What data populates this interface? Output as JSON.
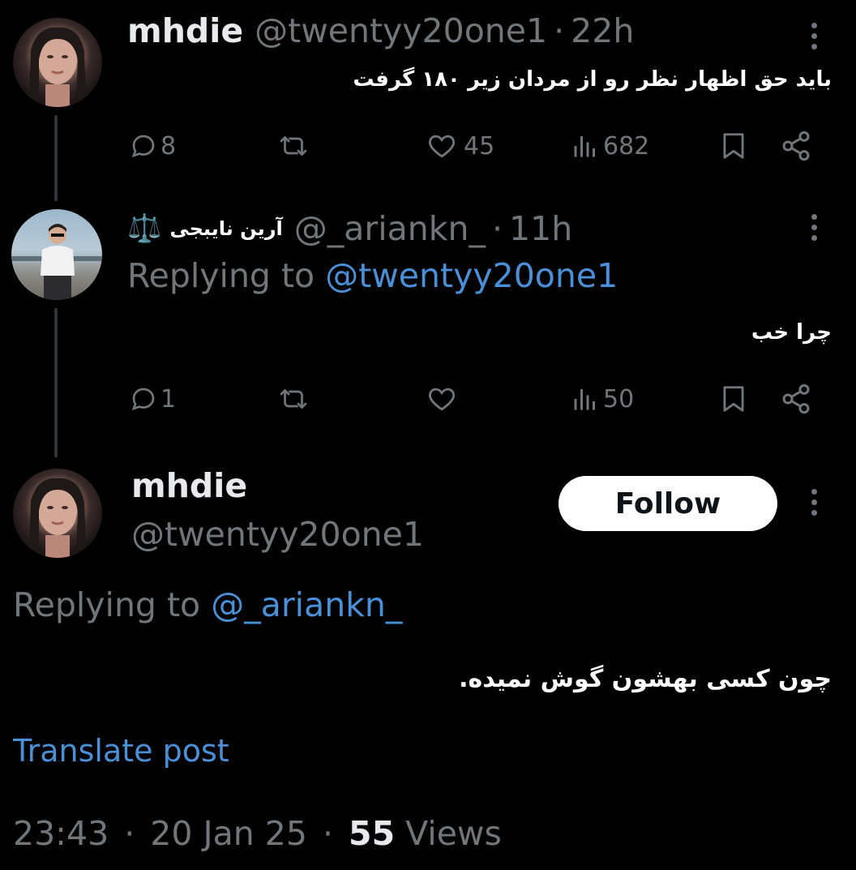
{
  "post1": {
    "name": "mhdie",
    "handle": "@twentyy20one1",
    "separator": "·",
    "time": "22h",
    "text": "باید حق اظهار نظر رو از مردان زیر ۱۸۰ گرفت",
    "replies": "8",
    "likes": "45",
    "views": "682"
  },
  "post2": {
    "name": "آرین نایبجی",
    "name_emoji": "⚖️",
    "handle": "@_ariankn_",
    "separator": "·",
    "time": "11h",
    "replying_prefix": "Replying to",
    "replying_handle": "@twentyy20one1",
    "text": "چرا خب",
    "replies": "1",
    "views": "50"
  },
  "main": {
    "name": "mhdie",
    "handle": "@twentyy20one1",
    "follow_label": "Follow",
    "replying_prefix": "Replying to",
    "replying_handle": "@_ariankn_",
    "text": "چون کسی بهشون گوش نمیده.",
    "translate_label": "Translate post",
    "time": "23:43",
    "date": "20 Jan 25",
    "separator": "·",
    "views_count": "55",
    "views_label": "Views"
  },
  "colors": {
    "background": "#000000",
    "text": "#e7e9ea",
    "muted": "#71767b",
    "link": "#4a90d9"
  }
}
